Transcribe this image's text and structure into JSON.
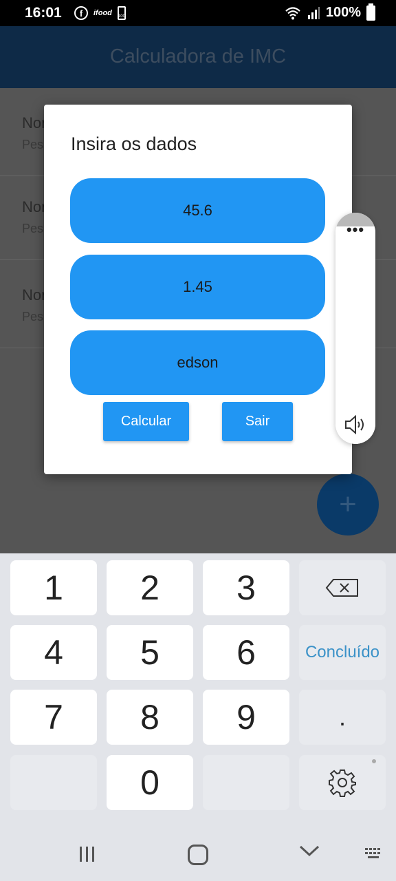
{
  "status_bar": {
    "time": "16:01",
    "battery_text": "100%",
    "battery_small_label": "100",
    "facebook_glyph": "f",
    "ifood_label": "ifood",
    "icons": [
      "facebook-icon",
      "ifood-icon",
      "battery-small-icon",
      "wifi-icon",
      "signal-icon",
      "battery-icon"
    ]
  },
  "app_bar": {
    "title": "Calculadora de IMC"
  },
  "list": {
    "items": [
      {
        "name": "Nor",
        "weight": "Pes"
      },
      {
        "name": "Nor",
        "weight": "Pes"
      },
      {
        "name": "Nor",
        "weight": "Pes"
      }
    ]
  },
  "fab": {
    "label": "+",
    "icon": "add-icon"
  },
  "dialog": {
    "title": "Insira os dados",
    "fields": [
      "45.6",
      "1.45",
      "edson"
    ],
    "calcular_label": "Calcular",
    "sair_label": "Sair"
  },
  "volume_panel": {
    "dots": "•••",
    "icon": "speaker-icon"
  },
  "keyboard": {
    "keys": [
      "1",
      "2",
      "3",
      "4",
      "5",
      "6",
      "7",
      "8",
      "9",
      "0"
    ],
    "done_label": "Concluído",
    "dot_label": ".",
    "icons": [
      "backspace-icon",
      "settings-icon"
    ]
  },
  "nav_bar": {
    "icons": [
      "recent-apps-icon",
      "home-icon",
      "back-icon",
      "keyboard-icon"
    ]
  },
  "colors": {
    "accent": "#2196f3",
    "app_bar": "#0e2a47",
    "keyboard_bg": "#e2e4e9",
    "done_text": "#3b92c8"
  }
}
